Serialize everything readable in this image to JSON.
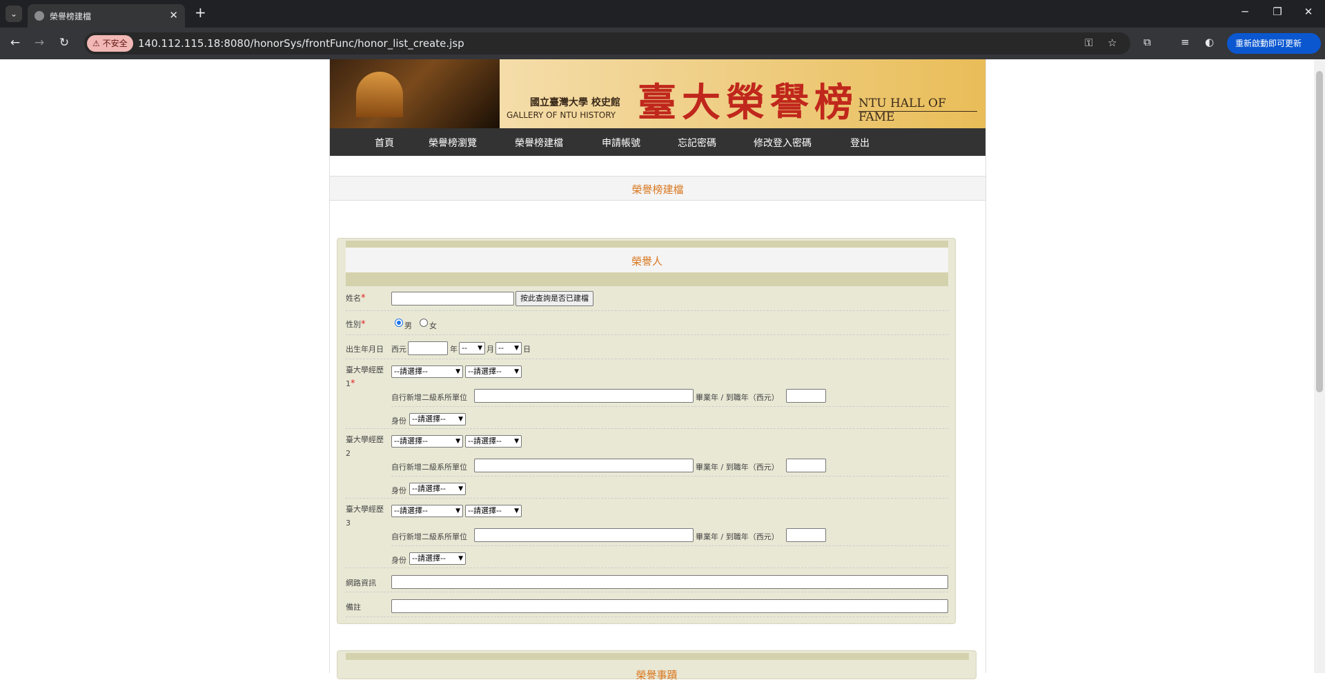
{
  "browser": {
    "tab_title": "榮譽榜建檔",
    "insecure_label": "不安全",
    "url": "140.112.115.18:8080/honorSys/frontFunc/honor_list_create.jsp",
    "update_button": "重新啟動即可更新"
  },
  "banner": {
    "university": "國立臺灣大學 校史館",
    "gallery": "GALLERY OF NTU HISTORY",
    "title": "臺大榮譽榜",
    "hall_of_fame": "NTU HALL OF FAME"
  },
  "nav": {
    "items": [
      "首頁",
      "榮譽榜瀏覽",
      "榮譽榜建檔",
      "申請帳號",
      "忘記密碼",
      "修改登入密碼",
      "登出"
    ]
  },
  "page": {
    "section_title": "榮譽榜建檔"
  },
  "form": {
    "panel_title": "榮譽人",
    "name_label": "姓名",
    "required_mark": "*",
    "check_button": "按此查詢是否已建檔",
    "gender_label": "性別",
    "gender_male": "男",
    "gender_female": "女",
    "gender_selected": "男",
    "birth_label": "出生年月日",
    "birth_prefix": "西元",
    "year_unit": "年",
    "month_value": "--",
    "month_unit": "月",
    "day_value": "--",
    "day_unit": "日",
    "exp1_label": "臺大學經歷1",
    "exp2_label": "臺大學經歷2",
    "exp3_label": "臺大學經歷3",
    "select_placeholder": "--請選擇--",
    "sub_unit_label": "自行新增二級系所單位",
    "grad_year_label": "畢業年 / 到職年（西元）",
    "identity_label": "身份",
    "web_info_label": "網路資訊",
    "remarks_label": "備註",
    "next_panel_title": "榮譽事蹟"
  }
}
